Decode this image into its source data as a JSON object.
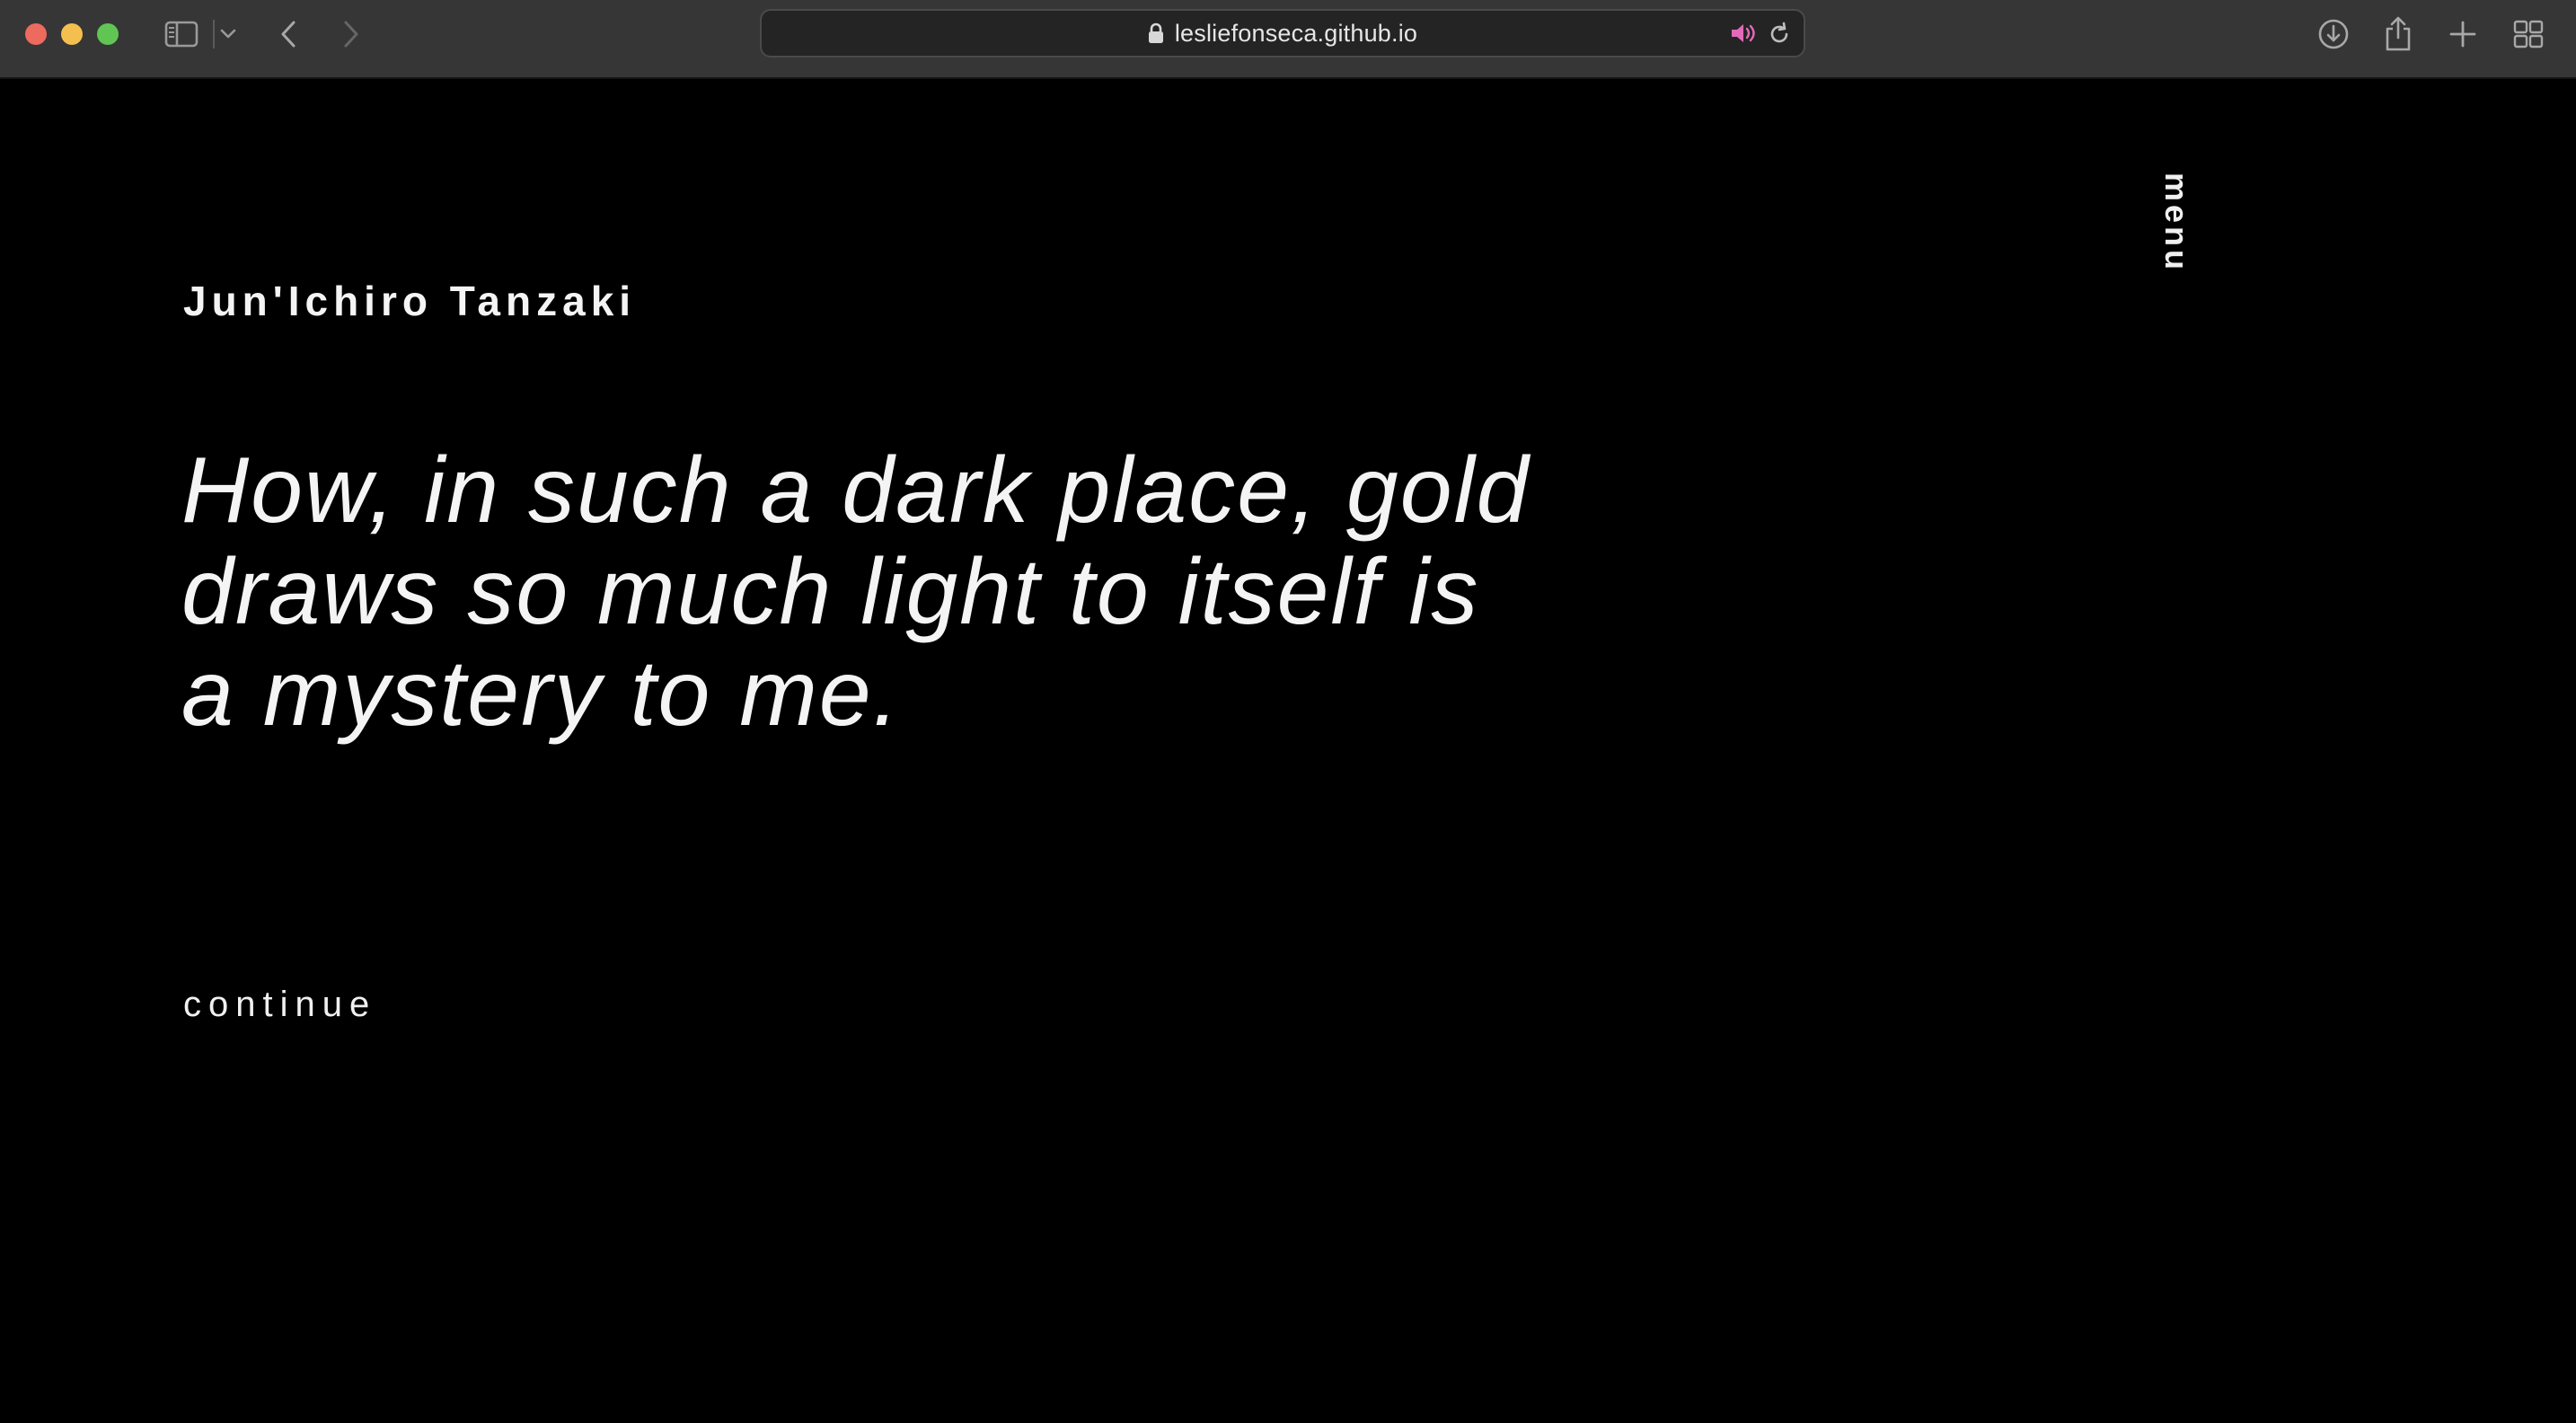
{
  "browser": {
    "url": "lesliefonseca.github.io",
    "icons": {
      "sidebar": "sidebar-icon",
      "tab_group": "chevron-down-icon",
      "back": "back-arrow-icon",
      "forward": "forward-arrow-icon",
      "lock": "lock-icon",
      "audio": "speaker-icon",
      "reload": "reload-icon",
      "downloads": "download-icon",
      "share": "share-icon",
      "new_tab": "plus-icon",
      "tab_overview": "grid-icon"
    },
    "colors": {
      "toolbar": "#363636",
      "audio_accent": "#e36ab8"
    }
  },
  "page": {
    "author": "Jun'Ichiro Tanzaki",
    "quote_lines": [
      "How, in such a dark place, gold",
      "draws so much light to itself is",
      "a mystery to me."
    ],
    "continue_label": "continue",
    "menu_label": "menu",
    "colors": {
      "background": "#000000",
      "text": "#f4f4f4"
    }
  }
}
